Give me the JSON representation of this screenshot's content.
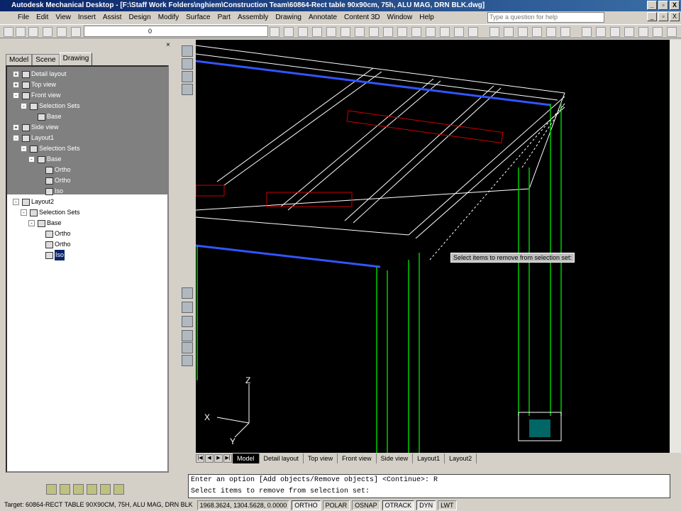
{
  "window": {
    "title": "Autodesk Mechanical Desktop - [F:\\Staff Work Folders\\nghiem\\Construction Team\\60864-Rect table 90x90cm, 75h, ALU MAG, DRN BLK.dwg]",
    "min": "_",
    "max": "▫",
    "close": "X"
  },
  "menu": [
    "File",
    "Edit",
    "View",
    "Insert",
    "Assist",
    "Design",
    "Modify",
    "Surface",
    "Part",
    "Assembly",
    "Drawing",
    "Annotate",
    "Content 3D",
    "Window",
    "Help"
  ],
  "help_placeholder": "Type a question for help",
  "layer": "0",
  "browser": {
    "close": "×",
    "tabs": [
      "Model",
      "Scene",
      "Drawing"
    ],
    "tree": [
      {
        "label": "Detail layout",
        "depth": 0,
        "pm": "+"
      },
      {
        "label": "Top view",
        "depth": 0,
        "pm": "+"
      },
      {
        "label": "Front view",
        "depth": 0,
        "pm": "-"
      },
      {
        "label": "Selection Sets",
        "depth": 1,
        "pm": "-"
      },
      {
        "label": "Base",
        "depth": 2,
        "pm": ""
      },
      {
        "label": "Side view",
        "depth": 0,
        "pm": "+"
      },
      {
        "label": "Layout1",
        "depth": 0,
        "pm": "-"
      },
      {
        "label": "Selection Sets",
        "depth": 1,
        "pm": "-"
      },
      {
        "label": "Base",
        "depth": 2,
        "pm": "-"
      },
      {
        "label": "Ortho",
        "depth": 3,
        "pm": ""
      },
      {
        "label": "Ortho",
        "depth": 3,
        "pm": ""
      },
      {
        "label": "Iso",
        "depth": 3,
        "pm": ""
      },
      {
        "label": "Layout2",
        "depth": 0,
        "pm": "-"
      },
      {
        "label": "Selection Sets",
        "depth": 1,
        "pm": "-"
      },
      {
        "label": "Base",
        "depth": 2,
        "pm": "-"
      },
      {
        "label": "Ortho",
        "depth": 3,
        "pm": ""
      },
      {
        "label": "Ortho",
        "depth": 3,
        "pm": ""
      },
      {
        "label": "Iso",
        "depth": 3,
        "pm": ""
      }
    ]
  },
  "viewport": {
    "tooltip": "Select items to remove from selection set:",
    "ucs": {
      "x": "X",
      "y": "Y",
      "z": "Z"
    }
  },
  "layout_tabs": [
    "Model",
    "Detail layout",
    "Top view",
    "Front view",
    "Side view",
    "Layout1",
    "Layout2"
  ],
  "command": {
    "line1": "Enter an option [Add objects/Remove objects] <Continue>: R",
    "line2": "Select items to remove from selection set:"
  },
  "status": {
    "target": "Target: 60864-RECT TABLE 90X90CM, 75H, ALU MAG, DRN BLK",
    "coords": "1968.3624, 1304.5628, 0.0000",
    "toggles": [
      {
        "label": "ORTHO",
        "on": true
      },
      {
        "label": "POLAR",
        "on": false
      },
      {
        "label": "OSNAP",
        "on": false
      },
      {
        "label": "OTRACK",
        "on": true
      },
      {
        "label": "DYN",
        "on": true
      },
      {
        "label": "LWT",
        "on": false
      }
    ]
  }
}
